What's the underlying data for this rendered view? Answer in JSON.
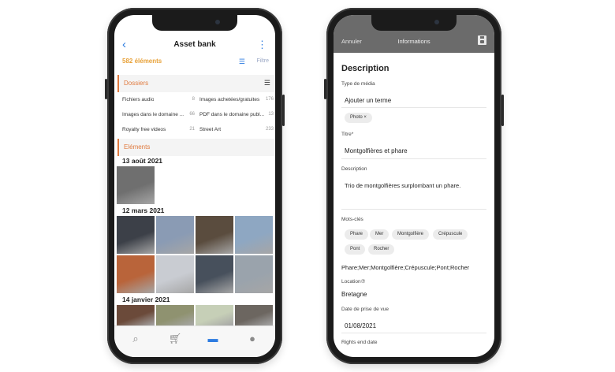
{
  "left_screen": {
    "nav": {
      "title": "Asset bank"
    },
    "count_text": "582 éléments",
    "filter_label": "Filtre",
    "folders_header": "Dossiers",
    "folders": [
      {
        "name": "Fichiers audio",
        "count": "8"
      },
      {
        "name": "Images achetées/gratuites",
        "count": "176"
      },
      {
        "name": "Images dans le domaine ...",
        "count": "66"
      },
      {
        "name": "PDF dans le domaine publ...",
        "count": "13"
      },
      {
        "name": "Royalty free videos",
        "count": "21"
      },
      {
        "name": "Street Art",
        "count": "233"
      }
    ],
    "elements_header": "Eléments",
    "date_groups": [
      {
        "date": "13 août 2021"
      },
      {
        "date": "12 mars 2021"
      },
      {
        "date": "14 janvier 2021"
      }
    ],
    "thumb_colors": {
      "g1": [
        "#6f6f6f"
      ],
      "g2": [
        "#3c4048",
        "#8a9bb4",
        "#5a4c3e",
        "#8ea7c2",
        "#b9643a",
        "#c9ccd2",
        "#47505c",
        "#9aa3ac"
      ],
      "g3": [
        "#6b4a3a",
        "#8f9270",
        "#c6cfb7",
        "#6c6660"
      ]
    },
    "tabs": [
      {
        "icon": "search-icon"
      },
      {
        "icon": "cart-icon"
      },
      {
        "icon": "folder-icon",
        "active": true
      },
      {
        "icon": "user-icon"
      }
    ],
    "colors": {
      "accent_blue": "#2f7de1",
      "accent_orange": "#e07a3e",
      "count_yellow": "#e8a23a"
    }
  },
  "right_screen": {
    "header": {
      "cancel": "Annuler",
      "title": "Informations"
    },
    "section_title": "Description",
    "media_type_label": "Type de média",
    "add_term_placeholder": "Ajouter un terme",
    "media_chip": "Photo ×",
    "title_label": "Titre*",
    "title_value": "Montgolfières et phare",
    "description_label": "Description",
    "description_value": "Trio de montgolfières surplombant un phare.",
    "keywords_label": "Mots-clés",
    "keywords": [
      "Phare",
      "Mer",
      "Montgolfière",
      "Crépuscule",
      "Pont",
      "Rocher"
    ],
    "keywords_joined": "Phare;Mer;Montgolfière;Crépuscule;Pont;Rocher",
    "location_label": "Location⑦",
    "location_value": "Bretagne",
    "shot_date_label": "Date de prise de vue",
    "shot_date_value": "01/08/2021",
    "rights_end_label": "Rights end date"
  }
}
